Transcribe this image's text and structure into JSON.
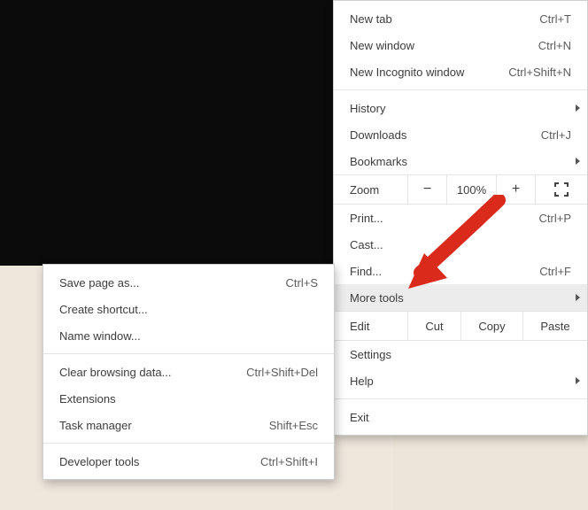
{
  "main_menu": {
    "new_tab": {
      "label": "New tab",
      "shortcut": "Ctrl+T"
    },
    "new_window": {
      "label": "New window",
      "shortcut": "Ctrl+N"
    },
    "new_incognito": {
      "label": "New Incognito window",
      "shortcut": "Ctrl+Shift+N"
    },
    "history": {
      "label": "History"
    },
    "downloads": {
      "label": "Downloads",
      "shortcut": "Ctrl+J"
    },
    "bookmarks": {
      "label": "Bookmarks"
    },
    "zoom": {
      "label": "Zoom",
      "minus": "−",
      "pct": "100%",
      "plus": "+"
    },
    "print": {
      "label": "Print...",
      "shortcut": "Ctrl+P"
    },
    "cast": {
      "label": "Cast..."
    },
    "find": {
      "label": "Find...",
      "shortcut": "Ctrl+F"
    },
    "more_tools": {
      "label": "More tools"
    },
    "edit": {
      "label": "Edit",
      "cut": "Cut",
      "copy": "Copy",
      "paste": "Paste"
    },
    "settings": {
      "label": "Settings"
    },
    "help": {
      "label": "Help"
    },
    "exit": {
      "label": "Exit"
    }
  },
  "sub_menu": {
    "save_page_as": {
      "label": "Save page as...",
      "shortcut": "Ctrl+S"
    },
    "create_shortcut": {
      "label": "Create shortcut..."
    },
    "name_window": {
      "label": "Name window..."
    },
    "clear_browsing_data": {
      "label": "Clear browsing data...",
      "shortcut": "Ctrl+Shift+Del"
    },
    "extensions": {
      "label": "Extensions"
    },
    "task_manager": {
      "label": "Task manager",
      "shortcut": "Shift+Esc"
    },
    "developer_tools": {
      "label": "Developer tools",
      "shortcut": "Ctrl+Shift+I"
    }
  }
}
